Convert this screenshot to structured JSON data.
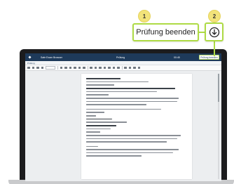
{
  "callouts": {
    "step1": "1",
    "step2": "2",
    "end_exam_label": "Prüfung beenden",
    "download_icon": "arrow-down-circle-icon"
  },
  "app": {
    "title": "Safe Exam Browser",
    "center_text": "Prüfung",
    "right_text": "00:45",
    "end_exam_label": "Prüfung beenden",
    "subbar_text": "Prüfung"
  },
  "colors": {
    "accent_green": "#aedb45",
    "step_yellow": "#f2e37a",
    "appbar_navy": "#1e3a5a"
  }
}
